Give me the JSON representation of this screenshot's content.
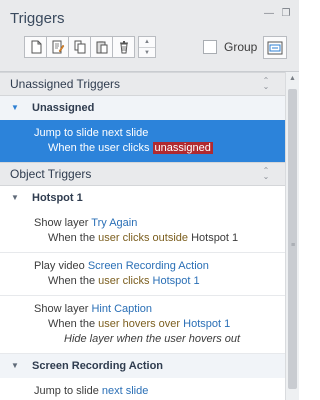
{
  "panel": {
    "title": "Triggers"
  },
  "toolbar": {
    "buttons": [
      "new-trigger-icon",
      "edit-trigger-icon",
      "copy-icon",
      "paste-icon",
      "delete-icon"
    ],
    "group_label": "Group"
  },
  "sections": {
    "unassigned": {
      "title": "Unassigned Triggers",
      "group_title": "Unassigned",
      "trigger": {
        "action": "Jump to slide next slide",
        "when": "When the user clicks ",
        "badge": "unassigned"
      }
    },
    "object": {
      "title": "Object Triggers",
      "hotspot1": {
        "title": "Hotspot 1",
        "t1": {
          "action": "Show layer ",
          "target": "Try Again",
          "when": "When the ",
          "kw": "user clicks outside",
          "object": " Hotspot 1"
        },
        "t2": {
          "action": "Play video ",
          "target": "Screen Recording Action",
          "when": "When the ",
          "kw": "user clicks",
          "object": "Hotspot 1"
        },
        "t3": {
          "action": "Show layer ",
          "target": "Hint Caption",
          "when": "When the ",
          "kw": "user hovers over",
          "object": "Hotspot 1",
          "extra": "Hide layer when the user hovers out"
        }
      },
      "screen_rec": {
        "title": "Screen Recording Action",
        "t1": {
          "action": "Jump to slide ",
          "target": "next slide"
        }
      }
    }
  },
  "colors": {
    "selection": "#2c83da",
    "link": "#2a6fb6",
    "keyword": "#7b5e1e",
    "badge": "#b02a30"
  }
}
